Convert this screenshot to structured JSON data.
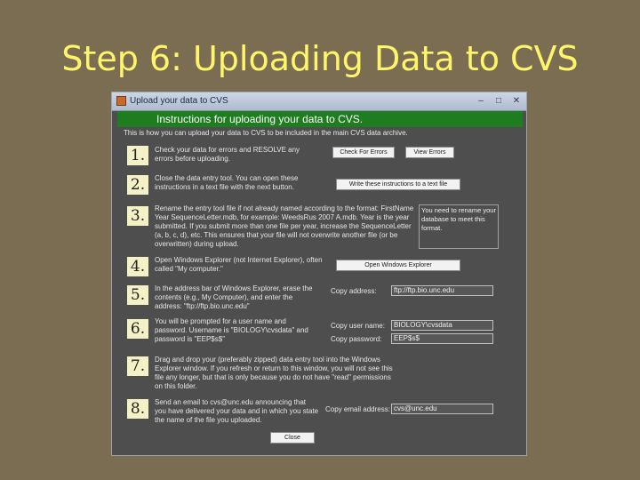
{
  "slide": {
    "title": "Step 6: Uploading Data to CVS"
  },
  "window": {
    "title": "Upload your data to CVS",
    "minimize": "–",
    "maximize": "□",
    "close": "✕"
  },
  "header": "Instructions for uploading your data to CVS.",
  "intro": "This is how you can upload your data to CVS to be included in the main CVS data archive.",
  "steps": [
    {
      "num": "1.",
      "text": "Check your data for errors and RESOLVE any errors before uploading.",
      "buttons": [
        "Check For Errors",
        "View Errors"
      ]
    },
    {
      "num": "2.",
      "text": "Close the data entry tool. You can open these instructions in a text file with the next button.",
      "buttons": [
        "Write these instructions to a text file"
      ]
    },
    {
      "num": "3.",
      "text": "Rename the entry tool file if not already named according to the format: FirstName Year SequenceLetter.mdb, for example: WeedsRus 2007 A.mdb. Year is the year submitted. If you submit more than one file per year, increase the SequenceLetter (a, b, c, d), etc. This ensures that your file will not overwrite another file (or be overwritten) during upload.",
      "tip": "You need to rename your database to meet this format."
    },
    {
      "num": "4.",
      "text": "Open Windows Explorer (not Internet Explorer), often called \"My computer.\"",
      "buttons": [
        "Open Windows Explorer"
      ]
    },
    {
      "num": "5.",
      "text": "In the address bar of Windows Explorer, erase the contents (e.g., My Computer), and enter the address: \"ftp://ftp.bio.unc.edu\"",
      "fields": [
        {
          "label": "Copy address:",
          "value": "ftp://ftp.bio.unc.edu"
        }
      ]
    },
    {
      "num": "6.",
      "text": "You will be prompted for a user name and password. Username is \"BIOLOGY\\cvsdata\" and password is \"EEP$s$\"",
      "fields": [
        {
          "label": "Copy user name:",
          "value": "BIOLOGY\\cvsdata"
        },
        {
          "label": "Copy password:",
          "value": "EEP$s$"
        }
      ]
    },
    {
      "num": "7.",
      "text": "Drag and drop your (preferably zipped) data entry tool into the Windows Explorer window. If you refresh or return to this window, you will not see this file any longer, but that is only because you do not have \"read\" permissions on this folder."
    },
    {
      "num": "8.",
      "text": "Send an email to cvs@unc.edu announcing that you have delivered your data and in which you state the name of the file you uploaded.",
      "fields": [
        {
          "label": "Copy email address:",
          "value": "cvs@unc.edu"
        }
      ]
    }
  ],
  "close_button": "Close"
}
